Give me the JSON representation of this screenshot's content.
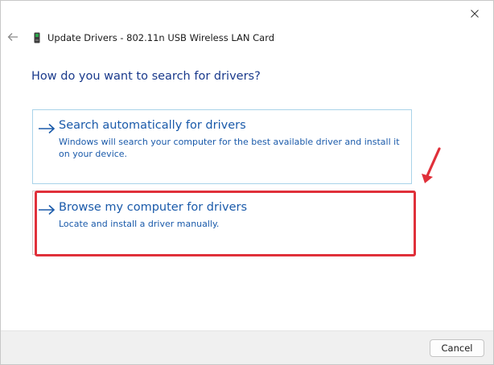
{
  "window": {
    "title": "Update Drivers - 802.11n USB Wireless LAN Card"
  },
  "icons": {
    "close": "close-icon",
    "back": "back-arrow-icon",
    "device": "device-icon",
    "option_arrow": "right-arrow-icon",
    "annotation": "red-annotation-arrow"
  },
  "heading": "How do you want to search for drivers?",
  "options": [
    {
      "title": "Search automatically for drivers",
      "description": "Windows will search your computer for the best available driver and install it on your device."
    },
    {
      "title": "Browse my computer for drivers",
      "description": "Locate and install a driver manually."
    }
  ],
  "footer": {
    "cancel_label": "Cancel"
  },
  "colors": {
    "heading": "#1a3a8c",
    "link": "#1a5aaa",
    "highlight": "#e0303a",
    "selected_border": "#a9d3e9",
    "footer_bg": "#f0f0f0"
  }
}
